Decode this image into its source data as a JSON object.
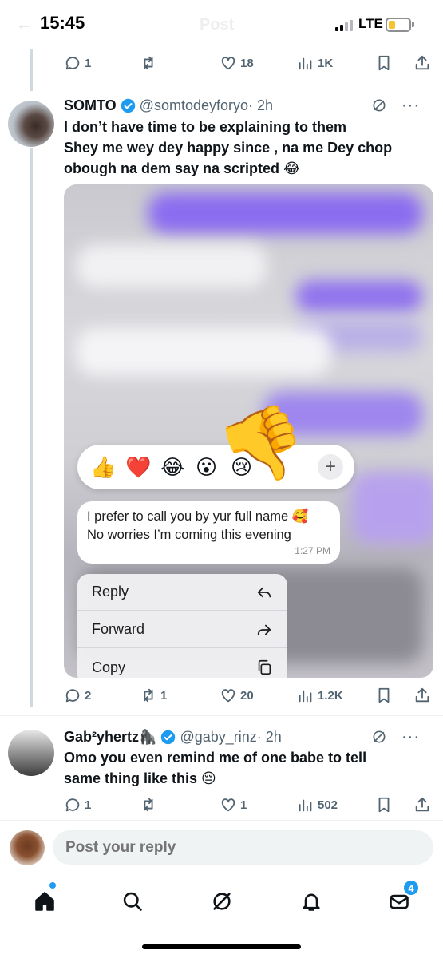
{
  "status_bar": {
    "time": "15:45",
    "network": "LTE",
    "ghost_title": "Post"
  },
  "top_actions": {
    "replies": "1",
    "reposts": "",
    "likes": "18",
    "views": "1K"
  },
  "tweet1": {
    "name": "SOMTO",
    "handle": "@somtodeyforyo",
    "time": "· 2h",
    "lines": [
      "I don’t have time to be explaining to them",
      "Shey me wey dey happy since , na me Dey chop",
      "obough na dem say na scripted 😂"
    ],
    "media": {
      "reactions": [
        "👍",
        "❤️",
        "😂",
        "😮",
        "😢"
      ],
      "reaction_plus": "+",
      "bubble_line1": "I prefer to call you by yur full name 🥰",
      "bubble_line2_prefix": "No worries I’m coming ",
      "bubble_line2_underlined": "this evening",
      "bubble_time": "1:27 PM",
      "menu": [
        "Reply",
        "Forward",
        "Copy"
      ]
    },
    "actions": {
      "replies": "2",
      "reposts": "1",
      "likes": "20",
      "views": "1.2K"
    }
  },
  "tweet2": {
    "name": "Gab²yhertz🦍",
    "handle": "@gaby_rinz",
    "time": "· 2h",
    "lines": [
      "Omo you even remind me of one babe to tell",
      "same thing like this 😔"
    ],
    "actions": {
      "replies": "1",
      "reposts": "",
      "likes": "1",
      "views": "502"
    }
  },
  "reply_bar": {
    "placeholder": "Post your reply"
  },
  "nav": {
    "messages_badge": "4"
  },
  "colors": {
    "accent": "#1d9bf0",
    "muted": "#536471",
    "text": "#0f1419"
  }
}
